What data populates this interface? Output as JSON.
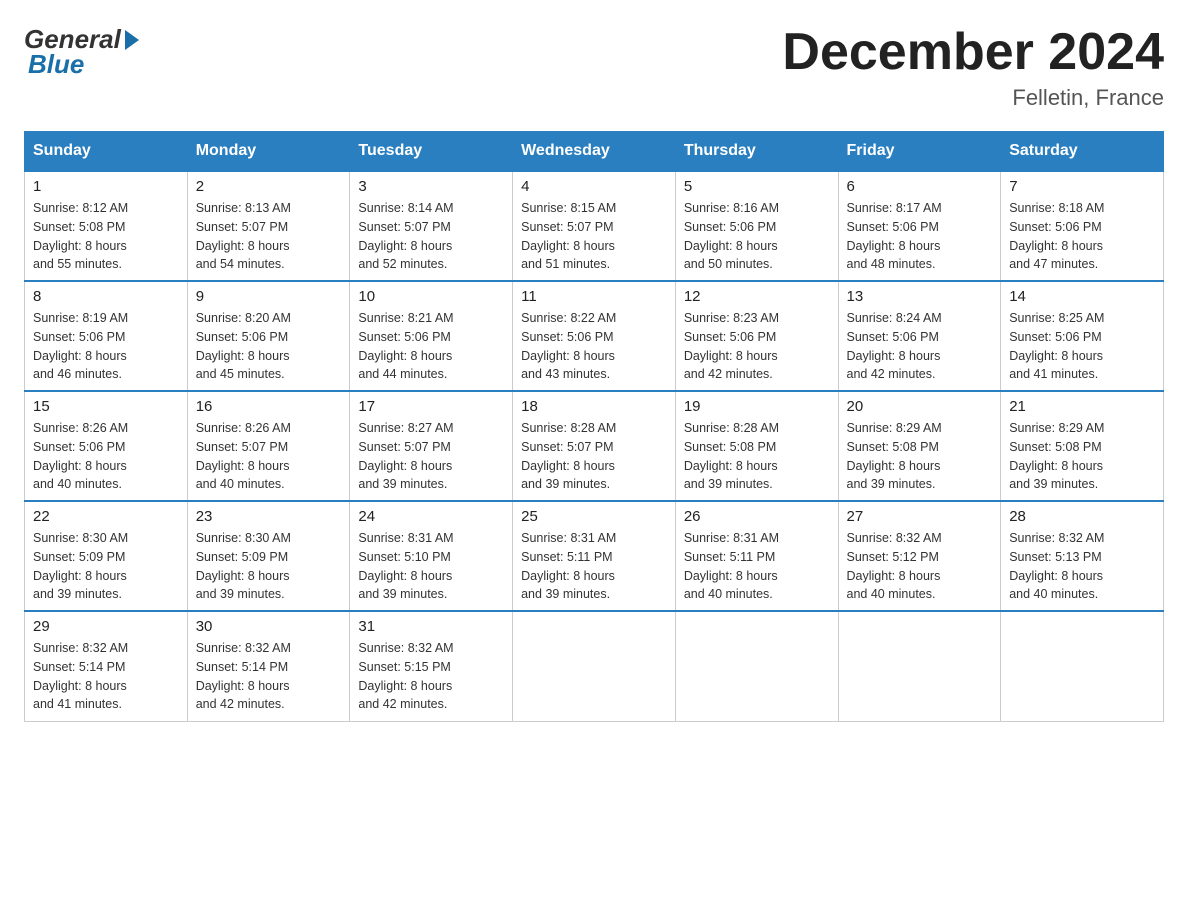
{
  "header": {
    "logo_general": "General",
    "logo_blue": "Blue",
    "month_title": "December 2024",
    "location": "Felletin, France"
  },
  "days_of_week": [
    "Sunday",
    "Monday",
    "Tuesday",
    "Wednesday",
    "Thursday",
    "Friday",
    "Saturday"
  ],
  "weeks": [
    [
      {
        "num": "1",
        "sunrise": "8:12 AM",
        "sunset": "5:08 PM",
        "daylight": "8 hours and 55 minutes."
      },
      {
        "num": "2",
        "sunrise": "8:13 AM",
        "sunset": "5:07 PM",
        "daylight": "8 hours and 54 minutes."
      },
      {
        "num": "3",
        "sunrise": "8:14 AM",
        "sunset": "5:07 PM",
        "daylight": "8 hours and 52 minutes."
      },
      {
        "num": "4",
        "sunrise": "8:15 AM",
        "sunset": "5:07 PM",
        "daylight": "8 hours and 51 minutes."
      },
      {
        "num": "5",
        "sunrise": "8:16 AM",
        "sunset": "5:06 PM",
        "daylight": "8 hours and 50 minutes."
      },
      {
        "num": "6",
        "sunrise": "8:17 AM",
        "sunset": "5:06 PM",
        "daylight": "8 hours and 48 minutes."
      },
      {
        "num": "7",
        "sunrise": "8:18 AM",
        "sunset": "5:06 PM",
        "daylight": "8 hours and 47 minutes."
      }
    ],
    [
      {
        "num": "8",
        "sunrise": "8:19 AM",
        "sunset": "5:06 PM",
        "daylight": "8 hours and 46 minutes."
      },
      {
        "num": "9",
        "sunrise": "8:20 AM",
        "sunset": "5:06 PM",
        "daylight": "8 hours and 45 minutes."
      },
      {
        "num": "10",
        "sunrise": "8:21 AM",
        "sunset": "5:06 PM",
        "daylight": "8 hours and 44 minutes."
      },
      {
        "num": "11",
        "sunrise": "8:22 AM",
        "sunset": "5:06 PM",
        "daylight": "8 hours and 43 minutes."
      },
      {
        "num": "12",
        "sunrise": "8:23 AM",
        "sunset": "5:06 PM",
        "daylight": "8 hours and 42 minutes."
      },
      {
        "num": "13",
        "sunrise": "8:24 AM",
        "sunset": "5:06 PM",
        "daylight": "8 hours and 42 minutes."
      },
      {
        "num": "14",
        "sunrise": "8:25 AM",
        "sunset": "5:06 PM",
        "daylight": "8 hours and 41 minutes."
      }
    ],
    [
      {
        "num": "15",
        "sunrise": "8:26 AM",
        "sunset": "5:06 PM",
        "daylight": "8 hours and 40 minutes."
      },
      {
        "num": "16",
        "sunrise": "8:26 AM",
        "sunset": "5:07 PM",
        "daylight": "8 hours and 40 minutes."
      },
      {
        "num": "17",
        "sunrise": "8:27 AM",
        "sunset": "5:07 PM",
        "daylight": "8 hours and 39 minutes."
      },
      {
        "num": "18",
        "sunrise": "8:28 AM",
        "sunset": "5:07 PM",
        "daylight": "8 hours and 39 minutes."
      },
      {
        "num": "19",
        "sunrise": "8:28 AM",
        "sunset": "5:08 PM",
        "daylight": "8 hours and 39 minutes."
      },
      {
        "num": "20",
        "sunrise": "8:29 AM",
        "sunset": "5:08 PM",
        "daylight": "8 hours and 39 minutes."
      },
      {
        "num": "21",
        "sunrise": "8:29 AM",
        "sunset": "5:08 PM",
        "daylight": "8 hours and 39 minutes."
      }
    ],
    [
      {
        "num": "22",
        "sunrise": "8:30 AM",
        "sunset": "5:09 PM",
        "daylight": "8 hours and 39 minutes."
      },
      {
        "num": "23",
        "sunrise": "8:30 AM",
        "sunset": "5:09 PM",
        "daylight": "8 hours and 39 minutes."
      },
      {
        "num": "24",
        "sunrise": "8:31 AM",
        "sunset": "5:10 PM",
        "daylight": "8 hours and 39 minutes."
      },
      {
        "num": "25",
        "sunrise": "8:31 AM",
        "sunset": "5:11 PM",
        "daylight": "8 hours and 39 minutes."
      },
      {
        "num": "26",
        "sunrise": "8:31 AM",
        "sunset": "5:11 PM",
        "daylight": "8 hours and 40 minutes."
      },
      {
        "num": "27",
        "sunrise": "8:32 AM",
        "sunset": "5:12 PM",
        "daylight": "8 hours and 40 minutes."
      },
      {
        "num": "28",
        "sunrise": "8:32 AM",
        "sunset": "5:13 PM",
        "daylight": "8 hours and 40 minutes."
      }
    ],
    [
      {
        "num": "29",
        "sunrise": "8:32 AM",
        "sunset": "5:14 PM",
        "daylight": "8 hours and 41 minutes."
      },
      {
        "num": "30",
        "sunrise": "8:32 AM",
        "sunset": "5:14 PM",
        "daylight": "8 hours and 42 minutes."
      },
      {
        "num": "31",
        "sunrise": "8:32 AM",
        "sunset": "5:15 PM",
        "daylight": "8 hours and 42 minutes."
      },
      null,
      null,
      null,
      null
    ]
  ],
  "labels": {
    "sunrise": "Sunrise:",
    "sunset": "Sunset:",
    "daylight": "Daylight:"
  }
}
